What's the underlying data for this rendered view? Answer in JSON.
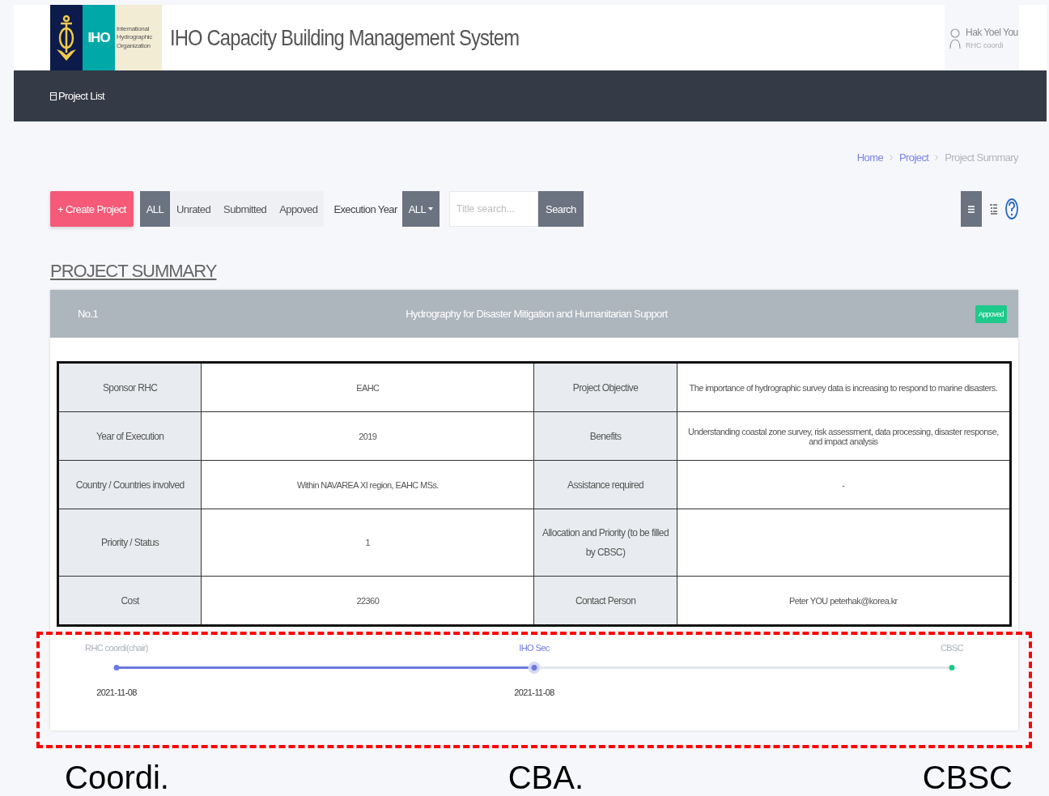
{
  "header": {
    "logo_text": "IHO",
    "logo_org": "International Hydrographic Organization",
    "title": "IHO Capacity Building Management System",
    "user": {
      "name": "Hak Yoel You",
      "role": "RHC coordi"
    }
  },
  "nav": {
    "items": [
      {
        "label": "Project List"
      }
    ]
  },
  "breadcrumb": [
    {
      "label": "Home",
      "current": false
    },
    {
      "label": "Project",
      "current": false
    },
    {
      "label": "Project Summary",
      "current": true
    }
  ],
  "toolbar": {
    "create_button": "+ Create Project",
    "filters": [
      {
        "label": "ALL",
        "selected": true
      },
      {
        "label": "Unrated",
        "selected": false
      },
      {
        "label": "Submitted",
        "selected": false
      },
      {
        "label": "Appoved",
        "selected": false
      }
    ],
    "year_label": "Execution Year",
    "year_dropdown": "ALL",
    "search": {
      "placeholder": "Title search..."
    },
    "search_button": "Search"
  },
  "section_title": "PROJECT SUMMARY",
  "project": {
    "number": "No.1",
    "title": "Hydrography for Disaster Mitigation and Humanitarian Support",
    "status": "Appoved",
    "rows": [
      {
        "label_1": "Sponsor RHC",
        "value_1": "EAHC",
        "label_2": "Project Objective",
        "value_2": "The importance of hydrographic survey data is increasing to respond to marine disasters."
      },
      {
        "label_1": "Year of Execution",
        "value_1": "2019",
        "label_2": "Benefits",
        "value_2": "Understanding coastal zone survey, risk assessment, data processing, disaster response, and impact analysis"
      },
      {
        "label_1": "Country / Countries involved",
        "value_1": "Within NAVAREA XI region, EAHC MSs.",
        "label_2": "Assistance required",
        "value_2": "-"
      },
      {
        "label_1": "Priority / Status",
        "value_1": "1",
        "label_2": "Allocation and Priority (to be filled by CBSC)"
      },
      {
        "label_1": "Cost",
        "value_1": "22360",
        "label_2": "Contact Person",
        "value_2": "Peter YOU peterhak@korea.kr"
      }
    ],
    "steps": [
      {
        "label": "RHC coordi(chair)",
        "date": "2021-11-08",
        "reached": true,
        "current": false
      },
      {
        "label": "IHO Sec",
        "date": "2021-11-08",
        "reached": true,
        "current": true
      },
      {
        "label": "CBSC",
        "reached": false,
        "current": false
      }
    ]
  },
  "annotation": {
    "labels": [
      "Coordi.",
      "CBA.",
      "CBSC"
    ]
  }
}
